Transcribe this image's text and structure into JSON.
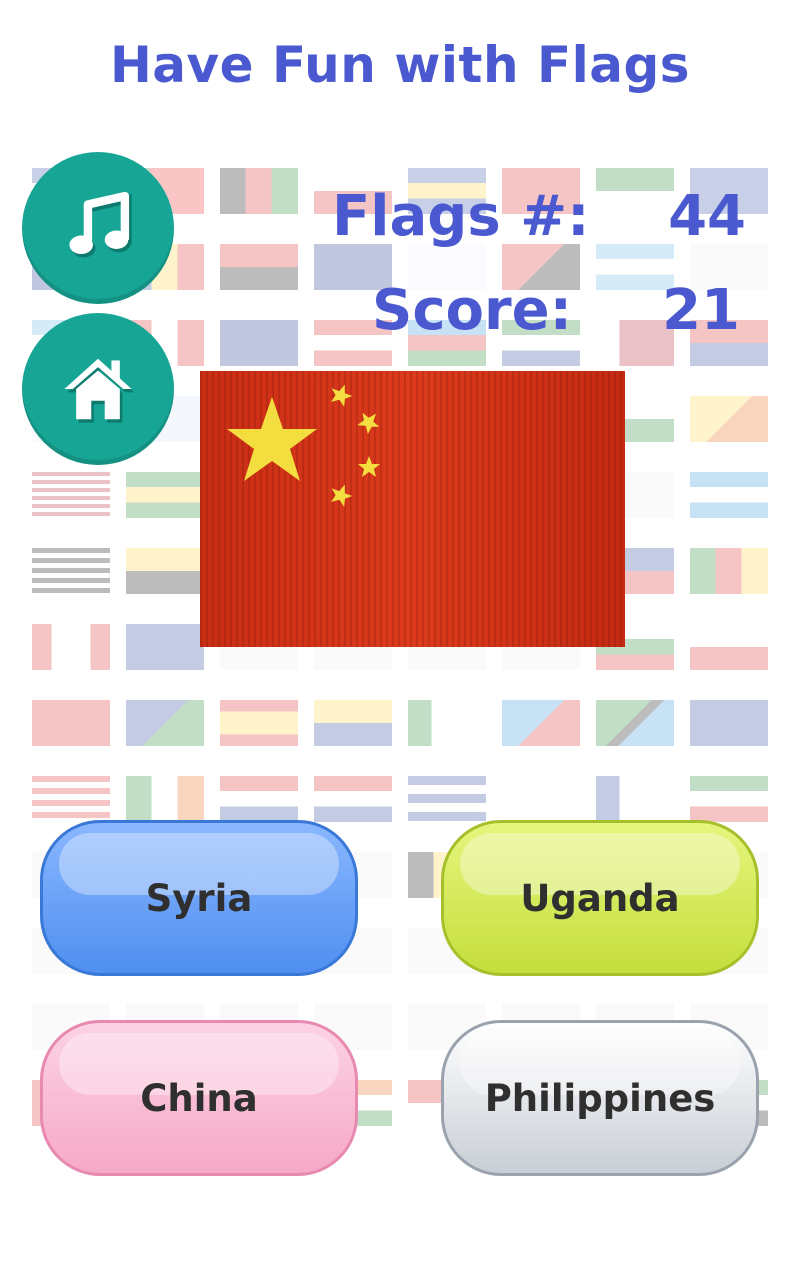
{
  "header": {
    "title": "Have Fun with Flags"
  },
  "controls": {
    "music_icon": "music-note-icon",
    "home_icon": "home-icon"
  },
  "stats": {
    "flags_label": "Flags #:",
    "flags_value": "44",
    "score_label": "Score:",
    "score_value": "21"
  },
  "question": {
    "flag": "china-flag",
    "flag_colors": {
      "red": "#d8361a",
      "yellow": "#f3dd3f"
    }
  },
  "answers": [
    {
      "label": "Syria",
      "color": "#5a97f2"
    },
    {
      "label": "Uganda",
      "color": "#cfe34b"
    },
    {
      "label": "China",
      "color": "#f7b3cf"
    },
    {
      "label": "Philippines",
      "color": "#e3e6ea"
    }
  ],
  "colors": {
    "accent": "#4a59d0",
    "round_button": "#17a595"
  }
}
